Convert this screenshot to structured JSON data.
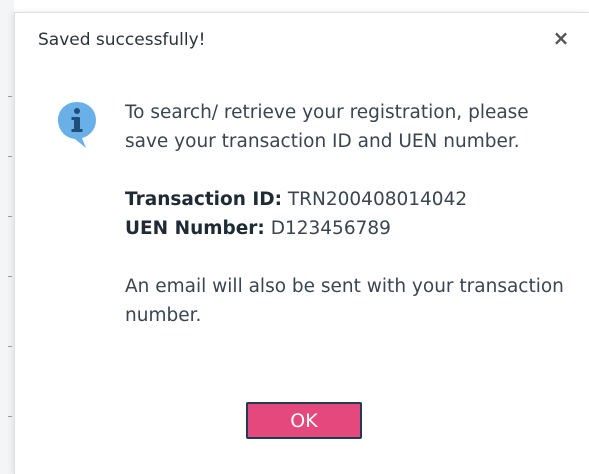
{
  "dialog": {
    "title": "Saved successfully!",
    "close_symbol": "×",
    "icon": "info-icon",
    "message": "To search/ retrieve your registration, please save your transaction ID and UEN number.",
    "transaction_label": "Transaction ID:",
    "transaction_value": "TRN200408014042",
    "uen_label": "UEN Number:",
    "uen_value": "D123456789",
    "email_note": "An email will also be sent with your transaction number.",
    "ok_label": "OK"
  },
  "colors": {
    "ok_button": "#e4487c",
    "ok_border": "#1f3b57",
    "info_icon": "#6ab0e8"
  }
}
